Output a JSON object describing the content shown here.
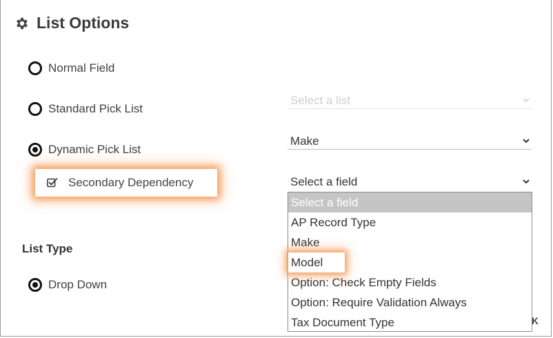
{
  "dialog": {
    "title": "List Options",
    "icon": "gear-icon"
  },
  "field_type_options": [
    {
      "label": "Normal Field",
      "checked": false
    },
    {
      "label": "Standard Pick List",
      "checked": false
    },
    {
      "label": "Dynamic Pick List",
      "checked": true
    }
  ],
  "secondary_dependency": {
    "label": "Secondary Dependency",
    "checked": true,
    "icon": "checkbox-checked-icon"
  },
  "selects": {
    "standard_list": {
      "value": "Select a list",
      "disabled": true
    },
    "dynamic_list": {
      "value": "Make"
    },
    "dependency_field": {
      "value": "Select a field"
    }
  },
  "dependency_dropdown": {
    "options": [
      "Select a field",
      "AP Record Type",
      "Make",
      "Model",
      "Option: Check Empty Fields",
      "Option: Require Validation Always",
      "Tax Document Type"
    ],
    "selected_index": 0,
    "highlighted_index": 3
  },
  "list_type": {
    "label": "List Type",
    "options": [
      {
        "label": "Drop Down",
        "checked": true
      }
    ]
  },
  "footer": {
    "ok_fragment": "K"
  },
  "colors": {
    "highlight_glow": "#f39046",
    "selected_option_bg": "#c5c5c5"
  }
}
